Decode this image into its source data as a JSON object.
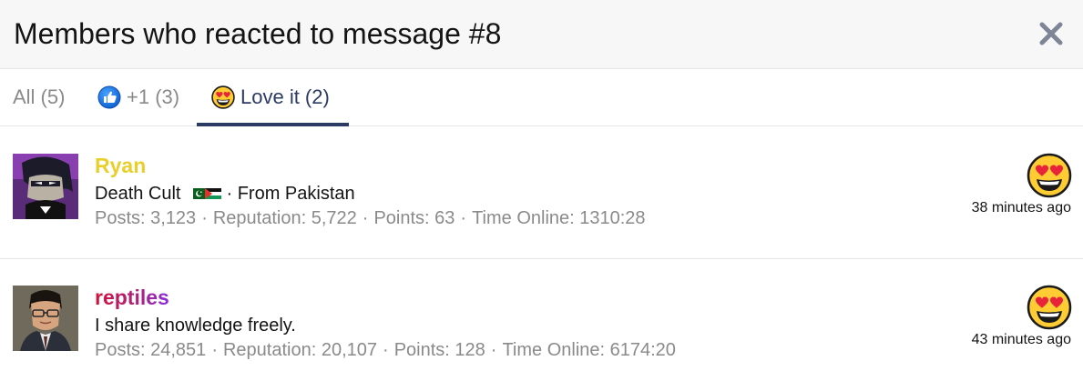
{
  "dialog": {
    "title": "Members who reacted to message #8"
  },
  "tabs": [
    {
      "label": "All (5)"
    },
    {
      "label": "+1 (3)",
      "icon": "thumbs-up-icon"
    },
    {
      "label": "Love it (2)",
      "icon": "heart-eyes-emoji-icon"
    }
  ],
  "members": [
    {
      "name": "Ryan",
      "name_color": "#e8cf2c",
      "title_text": "Death Cult",
      "flags": [
        "pakistan-flag-icon",
        "palestine-flag-icon"
      ],
      "location": "· From Pakistan",
      "posts": "Posts: 3,123",
      "reputation": "Reputation: 5,722",
      "points": "Points: 63",
      "time_online": "Time Online: 1310:28",
      "reaction_icon": "heart-eyes-emoji-icon",
      "time": "38 minutes ago"
    },
    {
      "name": "reptiles",
      "name_color": "#d1123a",
      "title_text": "I share knowledge freely.",
      "posts": "Posts: 24,851",
      "reputation": "Reputation: 20,107",
      "points": "Points: 128",
      "time_online": "Time Online: 6174:20",
      "reaction_icon": "heart-eyes-emoji-icon",
      "time": "43 minutes ago"
    }
  ],
  "separator": "·",
  "colors": {
    "active_tab": "#2b3b63",
    "muted_text": "#8a8a8a",
    "header_bg": "#f7f7f7"
  }
}
